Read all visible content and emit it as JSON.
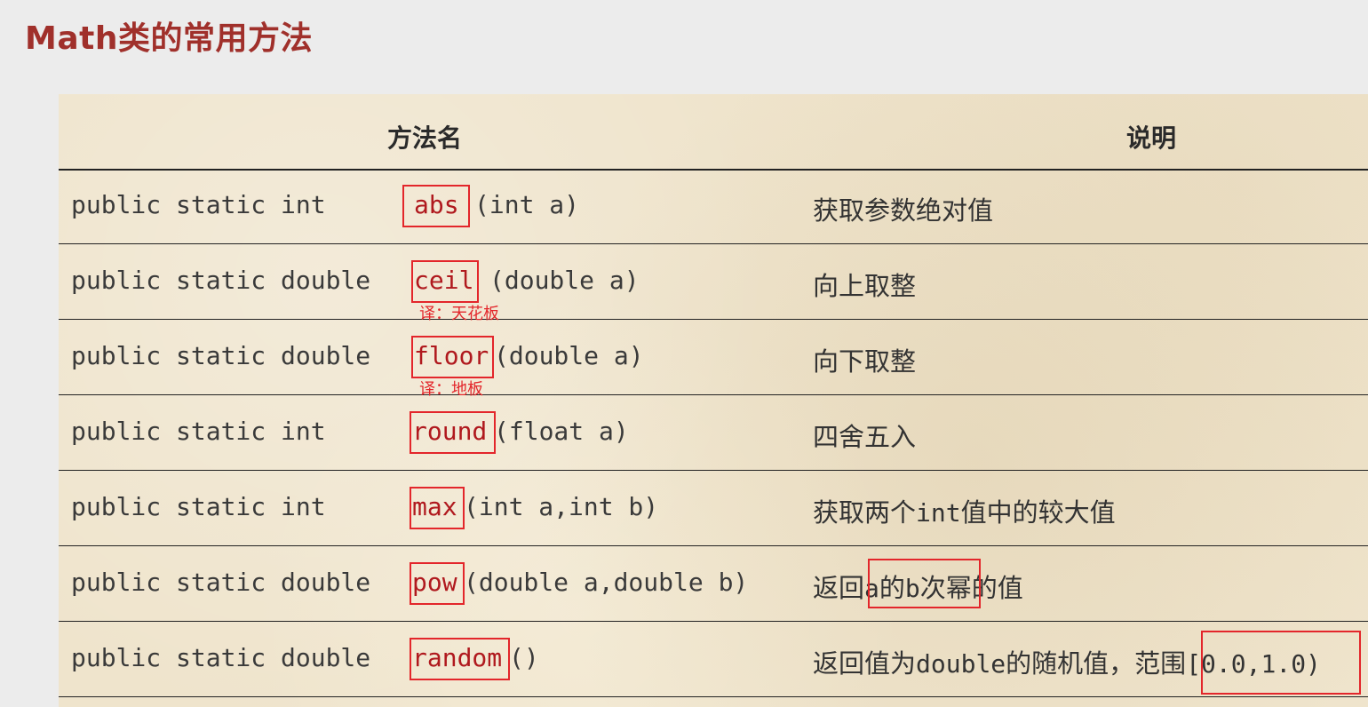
{
  "title": "Math类的常用方法",
  "table": {
    "headers": {
      "method": "方法名",
      "description": "说明"
    },
    "rows": [
      {
        "signature": "public static int",
        "method": "abs",
        "params": "(int a)",
        "description": "获取参数绝对值"
      },
      {
        "signature": "public static double",
        "method": "ceil",
        "params": "(double a)",
        "note": "译：天花板",
        "description": "向上取整"
      },
      {
        "signature": "public static double",
        "method": "floor",
        "params": "(double a)",
        "note": "译：地板",
        "description": "向下取整"
      },
      {
        "signature": "public static int",
        "method": "round",
        "params": "(float a)",
        "description": "四舍五入"
      },
      {
        "signature": "public static int",
        "method": "max",
        "params": "(int a,int b)",
        "description_parts": [
          "获取两个",
          "int",
          "值中的较大值"
        ]
      },
      {
        "signature": "public static double",
        "method": "pow",
        "params": "(double a,double b)",
        "description_parts": [
          "返回",
          "a",
          "的",
          "b",
          "次幂",
          "的值"
        ]
      },
      {
        "signature": "public static double",
        "method": "random",
        "params": "()",
        "description_parts": [
          "返回值为",
          "double",
          "的随机值，范围",
          "[0.0,1.0)"
        ]
      }
    ]
  },
  "annotation_color": "#e3262b",
  "title_color": "#a0302b",
  "method_color": "#b0191e"
}
